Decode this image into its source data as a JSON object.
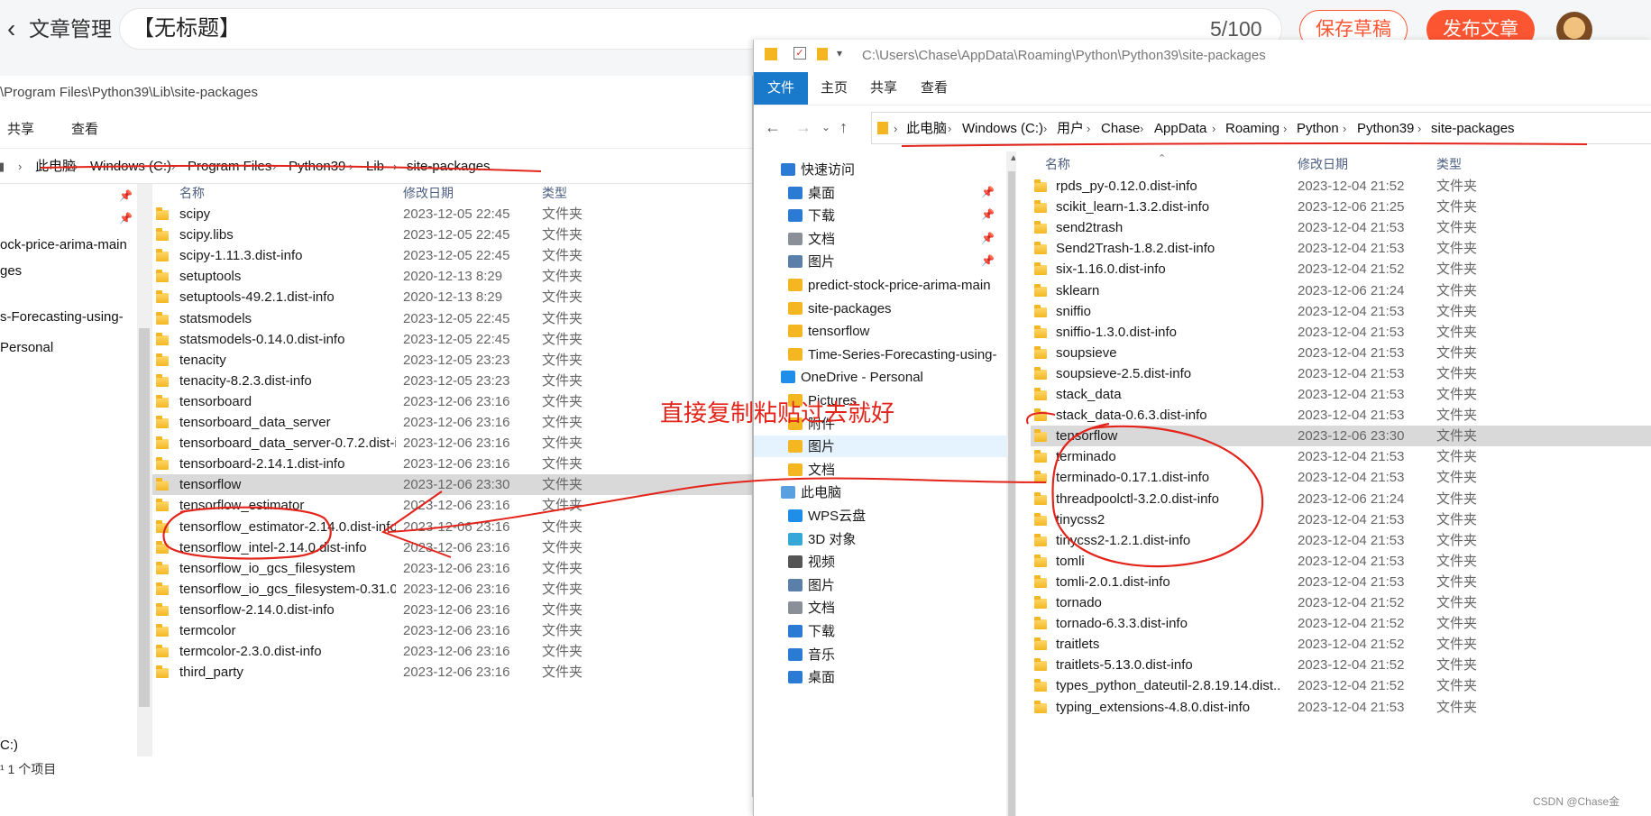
{
  "editor": {
    "back_icon": "chevron-left-icon",
    "section_label": "文章管理",
    "title_value": "【无标题】",
    "title_counter": "5/100",
    "save_draft_label": "保存草稿",
    "publish_label": "发布文章",
    "accent_color": "#fc5531"
  },
  "left_explorer": {
    "title_path": "\\Program Files\\Python39\\Lib\\site-packages",
    "ribbon_tabs": [
      "共享",
      "查看"
    ],
    "breadcrumb": [
      "此电脑",
      "Windows (C:)",
      "Program Files",
      "Python39",
      "Lib",
      "site-packages"
    ],
    "nav_items": [
      "ock-price-arima-main",
      "ges",
      "s-Forecasting-using-",
      "Personal",
      "C:)"
    ],
    "columns": {
      "name": "名称",
      "date": "修改日期",
      "type": "类型"
    },
    "rows": [
      {
        "name": "scipy",
        "date": "2023-12-05 22:45",
        "type": "文件夹"
      },
      {
        "name": "scipy.libs",
        "date": "2023-12-05 22:45",
        "type": "文件夹"
      },
      {
        "name": "scipy-1.11.3.dist-info",
        "date": "2023-12-05 22:45",
        "type": "文件夹"
      },
      {
        "name": "setuptools",
        "date": "2020-12-13 8:29",
        "type": "文件夹"
      },
      {
        "name": "setuptools-49.2.1.dist-info",
        "date": "2020-12-13 8:29",
        "type": "文件夹"
      },
      {
        "name": "statsmodels",
        "date": "2023-12-05 22:45",
        "type": "文件夹"
      },
      {
        "name": "statsmodels-0.14.0.dist-info",
        "date": "2023-12-05 22:45",
        "type": "文件夹"
      },
      {
        "name": "tenacity",
        "date": "2023-12-05 23:23",
        "type": "文件夹"
      },
      {
        "name": "tenacity-8.2.3.dist-info",
        "date": "2023-12-05 23:23",
        "type": "文件夹"
      },
      {
        "name": "tensorboard",
        "date": "2023-12-06 23:16",
        "type": "文件夹"
      },
      {
        "name": "tensorboard_data_server",
        "date": "2023-12-06 23:16",
        "type": "文件夹"
      },
      {
        "name": "tensorboard_data_server-0.7.2.dist-i...",
        "date": "2023-12-06 23:16",
        "type": "文件夹"
      },
      {
        "name": "tensorboard-2.14.1.dist-info",
        "date": "2023-12-06 23:16",
        "type": "文件夹"
      },
      {
        "name": "tensorflow",
        "date": "2023-12-06 23:30",
        "type": "文件夹",
        "selected": true
      },
      {
        "name": "tensorflow_estimator",
        "date": "2023-12-06 23:16",
        "type": "文件夹"
      },
      {
        "name": "tensorflow_estimator-2.14.0.dist-info",
        "date": "2023-12-06 23:16",
        "type": "文件夹"
      },
      {
        "name": "tensorflow_intel-2.14.0.dist-info",
        "date": "2023-12-06 23:16",
        "type": "文件夹"
      },
      {
        "name": "tensorflow_io_gcs_filesystem",
        "date": "2023-12-06 23:16",
        "type": "文件夹"
      },
      {
        "name": "tensorflow_io_gcs_filesystem-0.31.0....",
        "date": "2023-12-06 23:16",
        "type": "文件夹"
      },
      {
        "name": "tensorflow-2.14.0.dist-info",
        "date": "2023-12-06 23:16",
        "type": "文件夹"
      },
      {
        "name": "termcolor",
        "date": "2023-12-06 23:16",
        "type": "文件夹"
      },
      {
        "name": "termcolor-2.3.0.dist-info",
        "date": "2023-12-06 23:16",
        "type": "文件夹"
      },
      {
        "name": "third_party",
        "date": "2023-12-06 23:16",
        "type": "文件夹"
      }
    ],
    "status_text": "¹ 1 个项目"
  },
  "right_explorer": {
    "title_path": "C:\\Users\\Chase\\AppData\\Roaming\\Python\\Python39\\site-packages",
    "ribbon_tabs": [
      "文件",
      "主页",
      "共享",
      "查看"
    ],
    "breadcrumb": [
      "此电脑",
      "Windows (C:)",
      "用户",
      "Chase",
      "AppData",
      "Roaming",
      "Python",
      "Python39",
      "site-packages"
    ],
    "nav_items": [
      {
        "label": "快速访问",
        "icon": "star-icon",
        "level": 0
      },
      {
        "label": "桌面",
        "icon": "desktop-icon",
        "level": 1,
        "pinned": true
      },
      {
        "label": "下载",
        "icon": "download-icon",
        "level": 1,
        "pinned": true
      },
      {
        "label": "文档",
        "icon": "document-icon",
        "level": 1,
        "pinned": true
      },
      {
        "label": "图片",
        "icon": "picture-icon",
        "level": 1,
        "pinned": true
      },
      {
        "label": "predict-stock-price-arima-main",
        "icon": "folder-icon",
        "level": 1
      },
      {
        "label": "site-packages",
        "icon": "folder-icon",
        "level": 1
      },
      {
        "label": "tensorflow",
        "icon": "folder-icon",
        "level": 1
      },
      {
        "label": "Time-Series-Forecasting-using-",
        "icon": "folder-icon",
        "level": 1
      },
      {
        "label": "OneDrive - Personal",
        "icon": "cloud-icon",
        "level": 0
      },
      {
        "label": "Pictures",
        "icon": "folder-icon",
        "level": 1
      },
      {
        "label": "附件",
        "icon": "folder-icon",
        "level": 1
      },
      {
        "label": "图片",
        "icon": "folder-icon",
        "level": 1,
        "selected": true
      },
      {
        "label": "文档",
        "icon": "folder-icon",
        "level": 1
      },
      {
        "label": "此电脑",
        "icon": "computer-icon",
        "level": 0
      },
      {
        "label": "WPS云盘",
        "icon": "cloud-icon",
        "level": 1
      },
      {
        "label": "3D 对象",
        "icon": "cube-icon",
        "level": 1
      },
      {
        "label": "视频",
        "icon": "video-icon",
        "level": 1
      },
      {
        "label": "图片",
        "icon": "picture-icon",
        "level": 1
      },
      {
        "label": "文档",
        "icon": "document-icon",
        "level": 1
      },
      {
        "label": "下载",
        "icon": "download-icon",
        "level": 1
      },
      {
        "label": "音乐",
        "icon": "music-icon",
        "level": 1
      },
      {
        "label": "桌面",
        "icon": "desktop-icon",
        "level": 1
      }
    ],
    "columns": {
      "name": "名称",
      "date": "修改日期",
      "type": "类型"
    },
    "rows": [
      {
        "name": "rpds_py-0.12.0.dist-info",
        "date": "2023-12-04 21:52",
        "type": "文件夹"
      },
      {
        "name": "scikit_learn-1.3.2.dist-info",
        "date": "2023-12-06 21:25",
        "type": "文件夹"
      },
      {
        "name": "send2trash",
        "date": "2023-12-04 21:53",
        "type": "文件夹"
      },
      {
        "name": "Send2Trash-1.8.2.dist-info",
        "date": "2023-12-04 21:53",
        "type": "文件夹"
      },
      {
        "name": "six-1.16.0.dist-info",
        "date": "2023-12-04 21:52",
        "type": "文件夹"
      },
      {
        "name": "sklearn",
        "date": "2023-12-06 21:24",
        "type": "文件夹"
      },
      {
        "name": "sniffio",
        "date": "2023-12-04 21:53",
        "type": "文件夹"
      },
      {
        "name": "sniffio-1.3.0.dist-info",
        "date": "2023-12-04 21:53",
        "type": "文件夹"
      },
      {
        "name": "soupsieve",
        "date": "2023-12-04 21:53",
        "type": "文件夹"
      },
      {
        "name": "soupsieve-2.5.dist-info",
        "date": "2023-12-04 21:53",
        "type": "文件夹"
      },
      {
        "name": "stack_data",
        "date": "2023-12-04 21:53",
        "type": "文件夹"
      },
      {
        "name": "stack_data-0.6.3.dist-info",
        "date": "2023-12-04 21:53",
        "type": "文件夹"
      },
      {
        "name": "tensorflow",
        "date": "2023-12-06 23:30",
        "type": "文件夹",
        "selected": true
      },
      {
        "name": "terminado",
        "date": "2023-12-04 21:53",
        "type": "文件夹"
      },
      {
        "name": "terminado-0.17.1.dist-info",
        "date": "2023-12-04 21:53",
        "type": "文件夹"
      },
      {
        "name": "threadpoolctl-3.2.0.dist-info",
        "date": "2023-12-06 21:24",
        "type": "文件夹"
      },
      {
        "name": "tinycss2",
        "date": "2023-12-04 21:53",
        "type": "文件夹"
      },
      {
        "name": "tinycss2-1.2.1.dist-info",
        "date": "2023-12-04 21:53",
        "type": "文件夹"
      },
      {
        "name": "tomli",
        "date": "2023-12-04 21:53",
        "type": "文件夹"
      },
      {
        "name": "tomli-2.0.1.dist-info",
        "date": "2023-12-04 21:53",
        "type": "文件夹"
      },
      {
        "name": "tornado",
        "date": "2023-12-04 21:52",
        "type": "文件夹"
      },
      {
        "name": "tornado-6.3.3.dist-info",
        "date": "2023-12-04 21:52",
        "type": "文件夹"
      },
      {
        "name": "traitlets",
        "date": "2023-12-04 21:52",
        "type": "文件夹"
      },
      {
        "name": "traitlets-5.13.0.dist-info",
        "date": "2023-12-04 21:52",
        "type": "文件夹"
      },
      {
        "name": "types_python_dateutil-2.8.19.14.dist...",
        "date": "2023-12-04 21:52",
        "type": "文件夹"
      },
      {
        "name": "typing_extensions-4.8.0.dist-info",
        "date": "2023-12-04 21:53",
        "type": "文件夹"
      }
    ],
    "file_tab_color": "#1979ca"
  },
  "annotation": {
    "text": "直接复制粘贴过去就好",
    "color": "#e3241b"
  },
  "watermark": "CSDN @Chase金"
}
